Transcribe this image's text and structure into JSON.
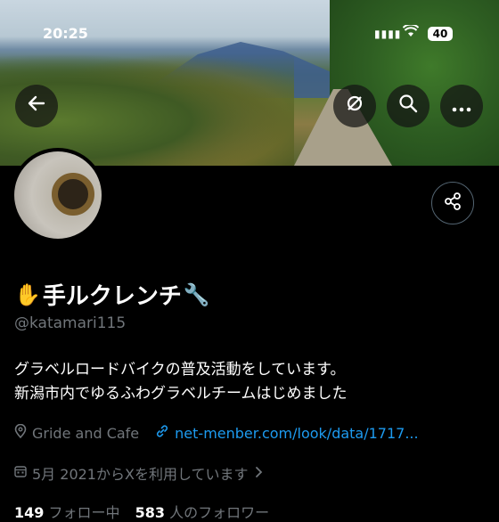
{
  "status_bar": {
    "time": "20:25",
    "battery": "40"
  },
  "profile": {
    "name": "手ルクレンチ",
    "name_prefix_emoji": "✋",
    "name_suffix_emoji": "🔧",
    "handle": "@katamari115",
    "bio_lines": [
      "グラベルロードバイクの普及活動をしています。",
      "新潟市内でゆるふわグラベルチームはじめました"
    ],
    "location": "Gride and Cafe",
    "website": "net-menber.com/look/data/1717...",
    "joined": "5月 2021からXを利用しています",
    "following_count": "149",
    "following_label": "フォロー中",
    "followers_count": "583",
    "followers_label": "人のフォロワー"
  },
  "icons": {
    "back": "arrow-left-icon",
    "refresh": "refresh-icon",
    "search": "search-icon",
    "more": "more-icon",
    "share": "share-icon",
    "location": "location-pin-icon",
    "link": "link-icon",
    "calendar": "calendar-icon",
    "chevron": "chevron-right-icon"
  },
  "colors": {
    "background": "#000000",
    "link": "#1d9bf0",
    "secondary_text": "#71767b"
  }
}
